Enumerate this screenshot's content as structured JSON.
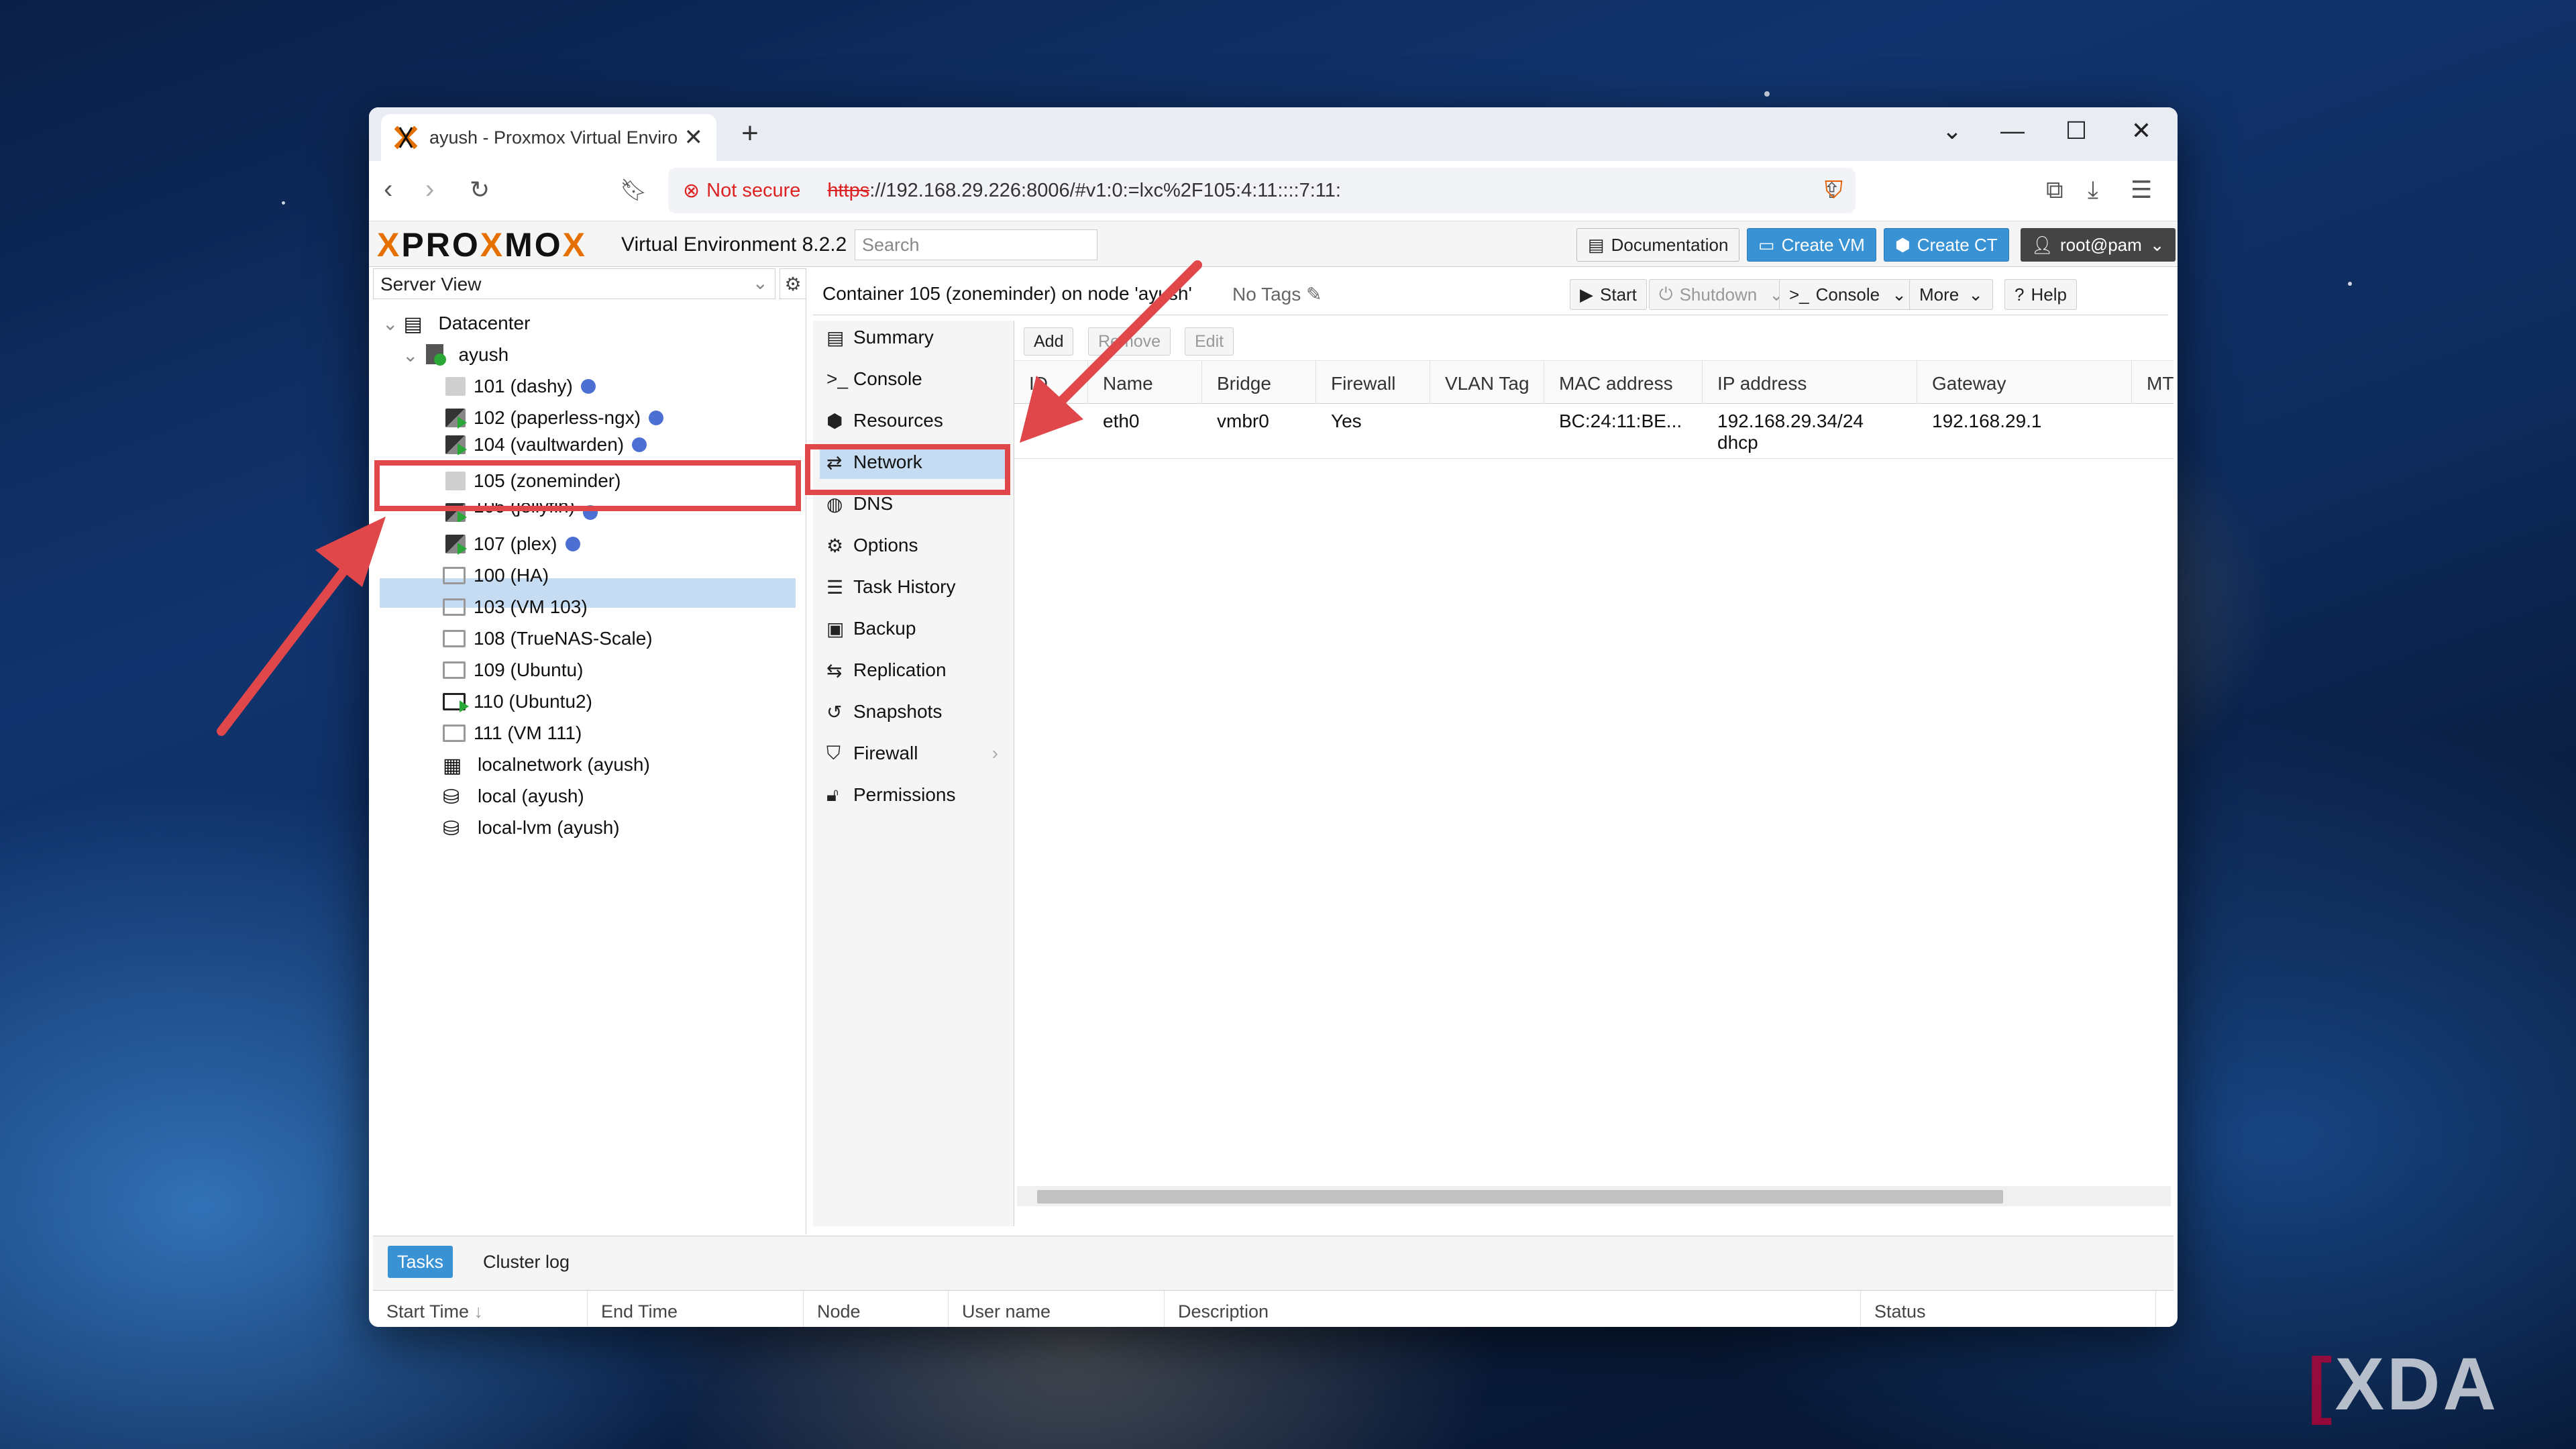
{
  "browser": {
    "tab_title": "ayush - Proxmox Virtual Enviro",
    "new_tab": "+",
    "not_secure": "Not secure",
    "url_scheme": "https",
    "url_rest": "://192.168.29.226:8006/#v1:0:=lxc%2F105:4:11::::7:11:"
  },
  "pve": {
    "logo_prefix": "PRO",
    "logo_x": "X",
    "logo_mid": "MO",
    "logo_x2": "X",
    "version": "Virtual Environment 8.2.2",
    "search_placeholder": "Search",
    "documentation": "Documentation",
    "create_vm": "Create VM",
    "create_ct": "Create CT",
    "user": "root@pam"
  },
  "left": {
    "view": "Server View",
    "tree": [
      {
        "label": "Datacenter"
      },
      {
        "label": "ayush"
      },
      {
        "label": "101 (dashy)"
      },
      {
        "label": "102 (paperless-ngx)"
      },
      {
        "label": "104 (vaultwarden)"
      },
      {
        "label": "105 (zoneminder)"
      },
      {
        "label": "106 (jellyfin)"
      },
      {
        "label": "107 (plex)"
      },
      {
        "label": "100 (HA)"
      },
      {
        "label": "103 (VM 103)"
      },
      {
        "label": "108 (TrueNAS-Scale)"
      },
      {
        "label": "109 (Ubuntu)"
      },
      {
        "label": "110 (Ubuntu2)"
      },
      {
        "label": "111 (VM 111)"
      },
      {
        "label": "localnetwork (ayush)"
      },
      {
        "label": "local (ayush)"
      },
      {
        "label": "local-lvm (ayush)"
      }
    ]
  },
  "content": {
    "title": "Container 105 (zoneminder) on node 'ayush'",
    "tags": "No Tags",
    "start": "Start",
    "shutdown": "Shutdown",
    "console": "Console",
    "more": "More",
    "help": "Help"
  },
  "menu": [
    {
      "label": "Summary"
    },
    {
      "label": "Console"
    },
    {
      "label": "Resources"
    },
    {
      "label": "Network"
    },
    {
      "label": "DNS"
    },
    {
      "label": "Options"
    },
    {
      "label": "Task History"
    },
    {
      "label": "Backup"
    },
    {
      "label": "Replication"
    },
    {
      "label": "Snapshots"
    },
    {
      "label": "Firewall"
    },
    {
      "label": "Permissions"
    }
  ],
  "grid": {
    "add": "Add",
    "remove": "Remove",
    "edit": "Edit",
    "columns": [
      "ID",
      "Name",
      "Bridge",
      "Firewall",
      "VLAN Tag",
      "MAC address",
      "IP address",
      "Gateway",
      "MTU"
    ],
    "rows": [
      {
        "id": "net0",
        "name": "eth0",
        "bridge": "vmbr0",
        "firewall": "Yes",
        "vlan": "",
        "mac": "BC:24:11:BE...",
        "ip": "192.168.29.34/24",
        "ip2": "dhcp",
        "gateway": "192.168.29.1",
        "mtu": ""
      }
    ]
  },
  "bottom": {
    "tabs": [
      "Tasks",
      "Cluster log"
    ],
    "columns": [
      "Start Time",
      "End Time",
      "Node",
      "User name",
      "Description",
      "Status"
    ]
  },
  "watermark": "XDA",
  "colors": {
    "accent": "#3892d4",
    "highlight": "#e0474a",
    "selection": "#c5dcf2",
    "running": "#2aa837"
  }
}
